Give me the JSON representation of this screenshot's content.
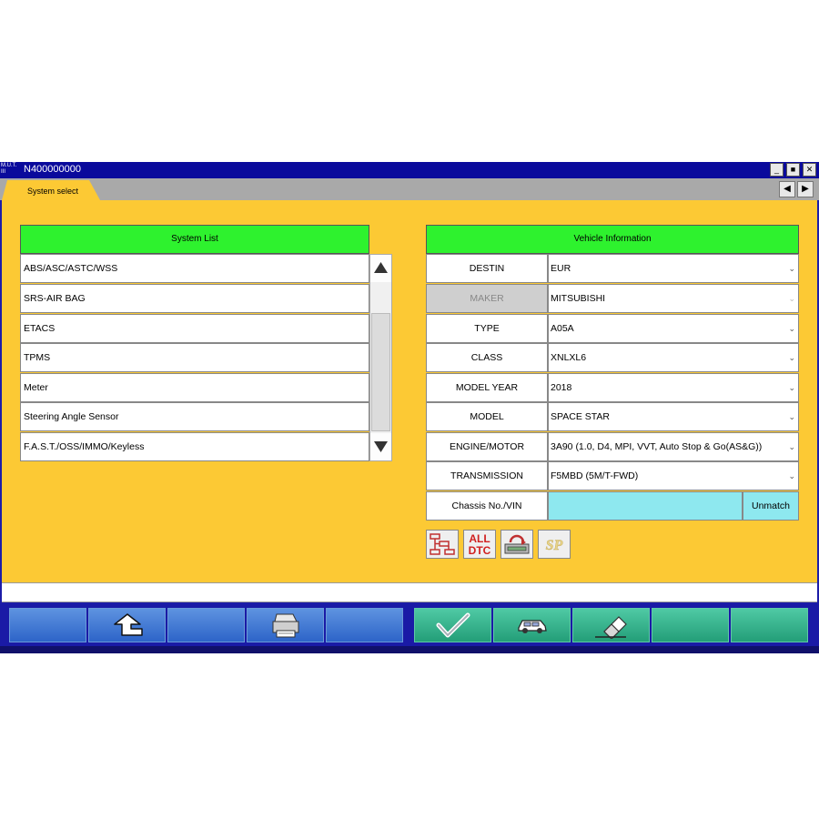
{
  "window": {
    "app_icon_text": "M.U.T.\nIII",
    "title": "N400000000",
    "controls": {
      "minimize": "_",
      "maximize": "■",
      "close": "✕"
    }
  },
  "tabs": {
    "active_label": "System select",
    "prev_arrow": "◀",
    "next_arrow": "▶"
  },
  "system_list": {
    "header": "System List",
    "items": [
      "ABS/ASC/ASTC/WSS",
      "SRS-AIR BAG",
      "ETACS",
      "TPMS",
      "Meter",
      "Steering Angle Sensor",
      "F.A.S.T./OSS/IMMO/Keyless"
    ]
  },
  "vehicle_info": {
    "header": "Vehicle Information",
    "rows": [
      {
        "label": "DESTIN",
        "value": "EUR",
        "enabled": true
      },
      {
        "label": "MAKER",
        "value": "MITSUBISHI",
        "enabled": false
      },
      {
        "label": "TYPE",
        "value": "A05A",
        "enabled": true
      },
      {
        "label": "CLASS",
        "value": "XNLXL6",
        "enabled": true
      },
      {
        "label": "MODEL YEAR",
        "value": "2018",
        "enabled": true
      },
      {
        "label": "MODEL",
        "value": "SPACE STAR",
        "enabled": true
      },
      {
        "label": "ENGINE/MOTOR",
        "value": "3A90 (1.0, D4, MPI, VVT, Auto Stop & Go(AS&G))",
        "enabled": true
      },
      {
        "label": "TRANSMISSION",
        "value": "F5MBD (5M/T-FWD)",
        "enabled": true
      }
    ],
    "vin_label": "Chassis No./VIN",
    "vin_value": "",
    "vin_status": "Unmatch",
    "dropdown_glyph": "⌄"
  },
  "tools": {
    "all_dtc_line1": "ALL",
    "all_dtc_line2": "DTC",
    "sp_label": "SP",
    "icons": [
      "system-tree-icon",
      "all-dtc-icon",
      "ecu-data-icon",
      "sp-icon"
    ]
  },
  "function_bar": {
    "icons": [
      "up-arrow-icon",
      "printer-icon",
      "checkmark-icon",
      "car-icon",
      "eraser-icon"
    ]
  },
  "colors": {
    "panel": "#fcc934",
    "header_green": "#2ef22e",
    "vin_cyan": "#8ee8ef",
    "window_blue": "#0a0a9c"
  }
}
